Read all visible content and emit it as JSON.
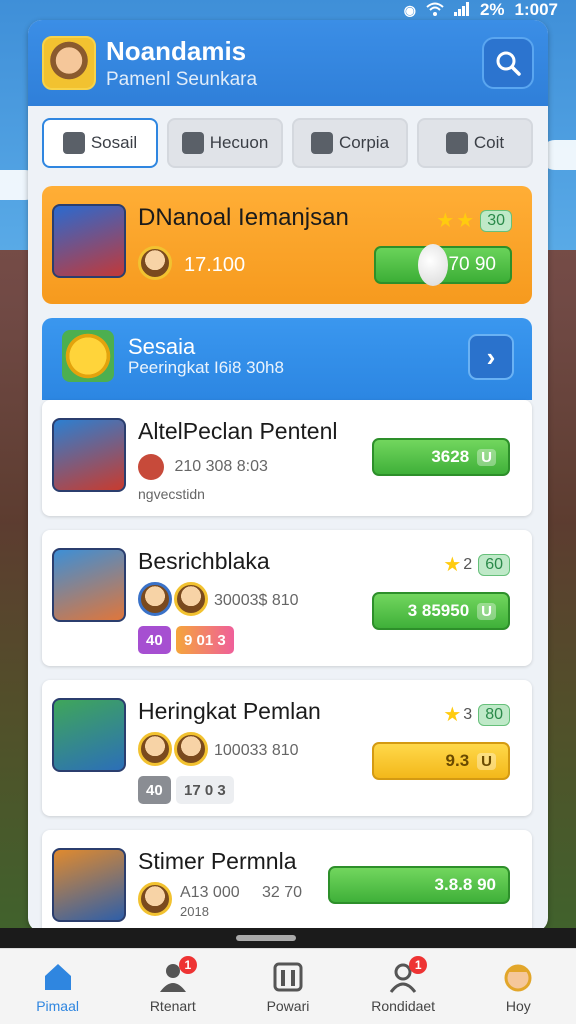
{
  "status_bar": {
    "battery": "2%",
    "time": "1:007"
  },
  "header": {
    "title": "Noandamis",
    "subtitle": "Pamenl Seunkara"
  },
  "tabs": [
    {
      "label": "Sosail",
      "icon": "pin-icon",
      "active": true
    },
    {
      "label": "Hecuon",
      "icon": "book-icon",
      "active": false
    },
    {
      "label": "Corpia",
      "icon": "tag-icon",
      "active": false
    },
    {
      "label": "Coit",
      "icon": "shield-icon",
      "active": false
    }
  ],
  "featured": {
    "title": "DNanoal Iemanjsan",
    "count": "17.100",
    "badge": "30",
    "action_value": "70 90"
  },
  "banner": {
    "title": "Sesaia",
    "subtitle": "Peeringkat I6i8 30h8"
  },
  "cards": [
    {
      "title": "AltelPeclan Pentenl",
      "line1": "210 308 8:03",
      "line2": "ngvecstidn",
      "action": "3628",
      "action_tag": "U",
      "action_color": "green"
    },
    {
      "title": "Besrichblaka",
      "line1": "30003$ 810",
      "stars_count": "2",
      "badge": "60",
      "action": "3 85950",
      "action_tag": "U",
      "action_color": "green",
      "tags": [
        "40",
        "9 01 3"
      ]
    },
    {
      "title": "Heringkat Pemlan",
      "line1": "100033 810",
      "stars_count": "3",
      "badge": "80",
      "action": "9.3",
      "action_tag": "U",
      "action_color": "yellow",
      "tags": [
        "40",
        "17 0 3"
      ]
    },
    {
      "title": "Stimer Permnla",
      "line1": "A13 000",
      "line1b": "32 70",
      "line2": "2018",
      "action": "3.8.8 90",
      "action_color": "green"
    }
  ],
  "nav": [
    {
      "label": "Pimaal",
      "icon": "home-icon",
      "active": true,
      "notif": ""
    },
    {
      "label": "Rtenart",
      "icon": "user-icon",
      "active": false,
      "notif": "1"
    },
    {
      "label": "Powari",
      "icon": "building-icon",
      "active": false,
      "notif": ""
    },
    {
      "label": "Rondidaet",
      "icon": "profile-icon",
      "active": false,
      "notif": "1"
    },
    {
      "label": "Hoy",
      "icon": "avatar-icon",
      "active": false,
      "notif": ""
    }
  ],
  "colors": {
    "accent": "#2f86e0",
    "featured": "#f69a1e",
    "green": "#3fb039",
    "yellow": "#f3b81a"
  }
}
